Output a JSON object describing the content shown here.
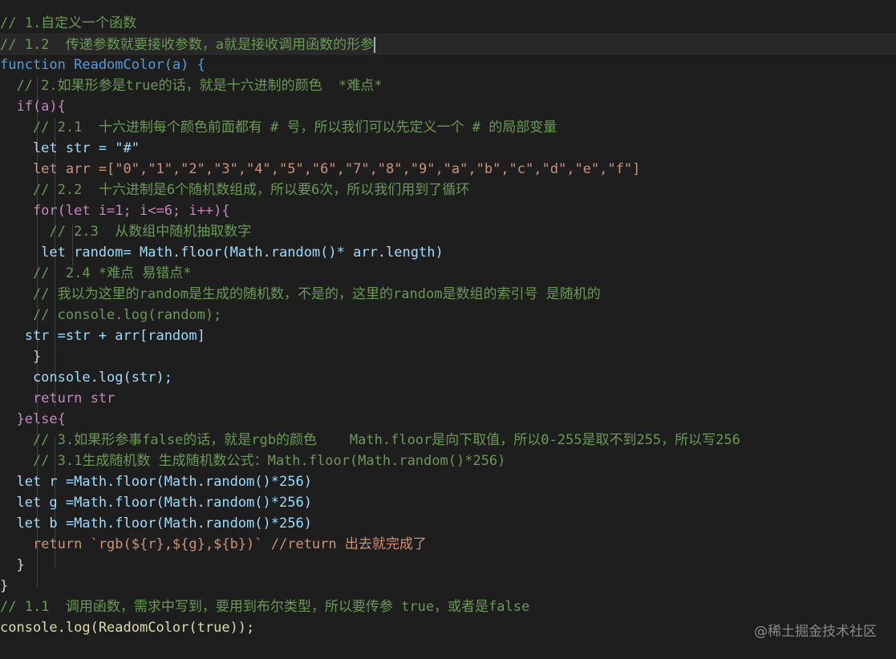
{
  "code_lines": [
    "// 1.自定义一个函数",
    "// 1.2  传递参数就要接收参数，a就是接收调用函数的形参",
    "function ReadomColor(a) {",
    "  // 2.如果形参是true的话，就是十六进制的颜色  *难点*",
    "  if(a){",
    "    // 2.1  十六进制每个颜色前面都有 # 号，所以我们可以先定义一个 # 的局部变量",
    "    let str = \"#\"",
    "    let arr =[\"0\",\"1\",\"2\",\"3\",\"4\",\"5\",\"6\",\"7\",\"8\",\"9\",\"a\",\"b\",\"c\",\"d\",\"e\",\"f\"]",
    "    // 2.2  十六进制是6个随机数组成，所以要6次，所以我们用到了循环",
    "    for(let i=1; i<=6; i++){",
    "      // 2.3  从数组中随机抽取数字",
    "     let random= Math.floor(Math.random()* arr.length)",
    "    //  2.4 *难点 易错点*",
    "    // 我以为这里的random是生成的随机数，不是的，这里的random是数组的索引号 是随机的",
    "    // console.log(random);",
    "   str =str + arr[random]",
    "    }",
    "    console.log(str);",
    "    return str",
    "  }else{",
    "    // 3.如果形参事false的话，就是rgb的颜色    Math.floor是向下取值，所以0-255是取不到255，所以写256",
    "    // 3.1生成随机数 生成随机数公式：Math.floor(Math.random()*256)",
    "  let r =Math.floor(Math.random()*256)",
    "  let g =Math.floor(Math.random()*256)",
    "  let b =Math.floor(Math.random()*256)",
    "    return `rgb(${r},${g},${b})` //return 出去就完成了",
    "  }",
    "}",
    "// 1.1  调用函数，需求中写到，要用到布尔类型，所以要传参 true，或者是false",
    "console.log(ReadomColor(true));"
  ],
  "watermark": "@稀土掘金技术社区",
  "colors": {
    "background": "#1e1e1e",
    "comment": "#6a9955",
    "keyword": "#569cd6",
    "function": "#dcdcaa",
    "variable": "#9cdcfe",
    "string": "#ce9178",
    "number": "#b5cea8",
    "control": "#c586c0"
  }
}
